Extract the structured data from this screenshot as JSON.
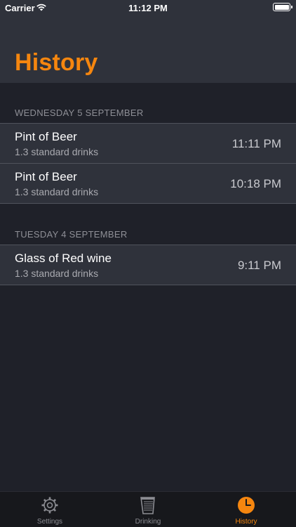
{
  "status_bar": {
    "carrier": "Carrier",
    "time": "11:12 PM"
  },
  "header": {
    "title": "History"
  },
  "sections": [
    {
      "date": "WEDNESDAY 5 SEPTEMBER",
      "entries": [
        {
          "name": "Pint of Beer",
          "detail": "1.3 standard drinks",
          "time": "11:11 PM"
        },
        {
          "name": "Pint of Beer",
          "detail": "1.3 standard drinks",
          "time": "10:18 PM"
        }
      ]
    },
    {
      "date": "TUESDAY 4 SEPTEMBER",
      "entries": [
        {
          "name": "Glass of Red wine",
          "detail": "1.3 standard drinks",
          "time": "9:11 PM"
        }
      ]
    }
  ],
  "tabbar": {
    "tabs": [
      {
        "label": "Settings",
        "icon": "gear-icon"
      },
      {
        "label": "Drinking",
        "icon": "glass-icon"
      },
      {
        "label": "History",
        "icon": "clock-icon",
        "active": true
      }
    ]
  },
  "colors": {
    "accent": "#f5860f",
    "background": "#1f2129",
    "cell": "#2f323b"
  }
}
